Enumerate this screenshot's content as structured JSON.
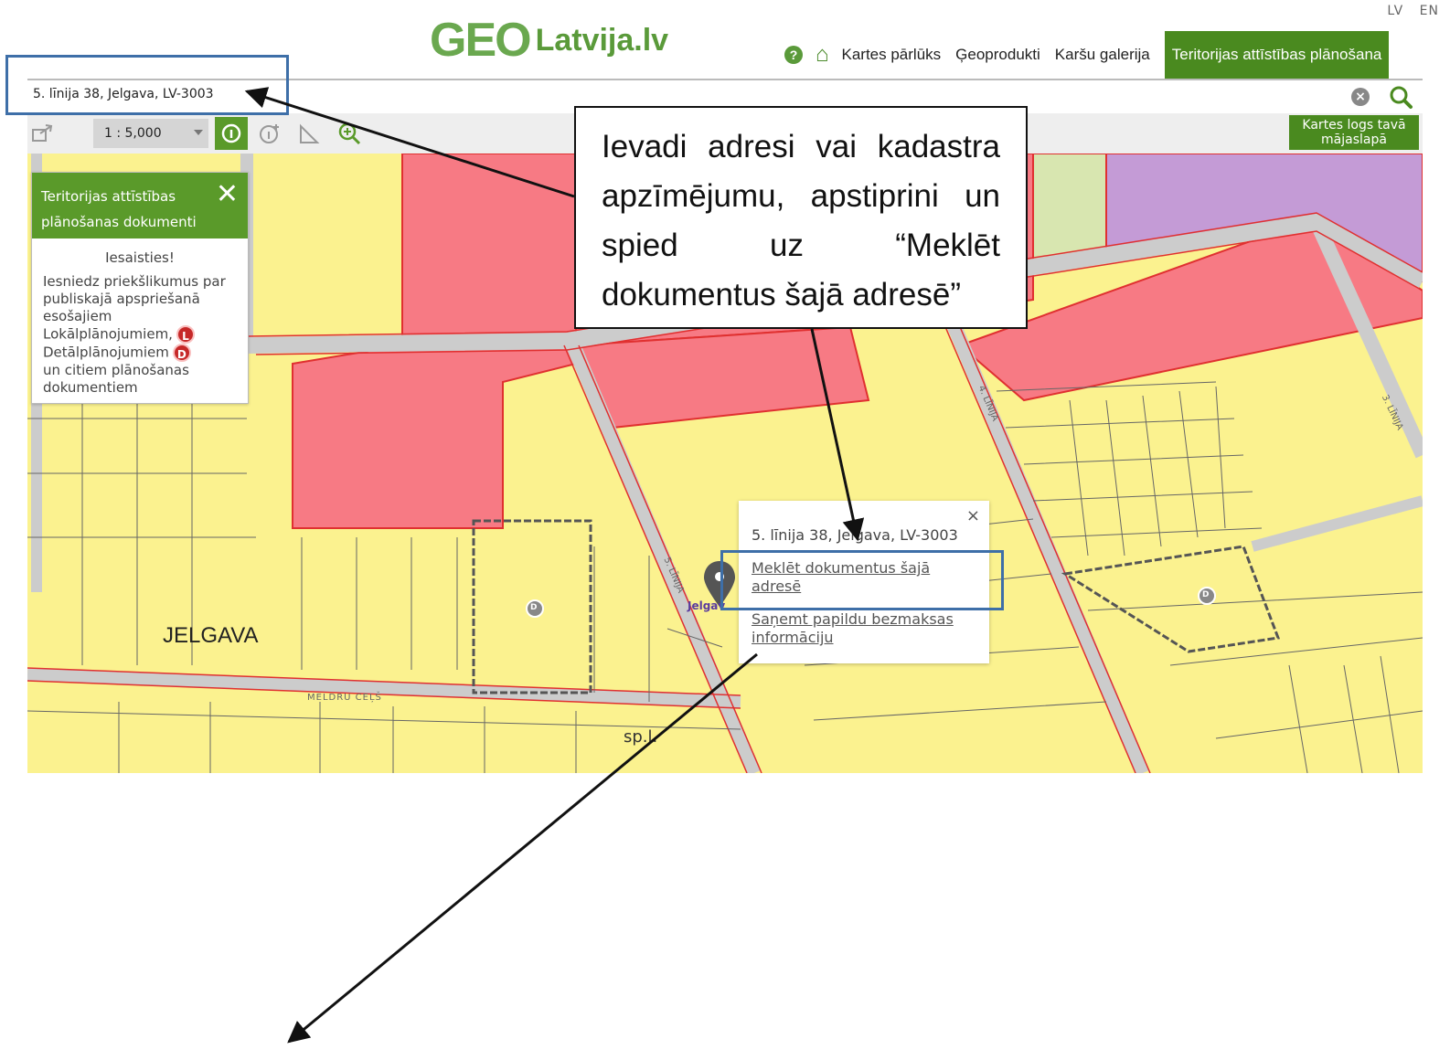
{
  "header": {
    "languages": [
      "LV",
      "EN"
    ],
    "logo": {
      "geo": "GEO",
      "rest": "Latvija.lv"
    },
    "nav": {
      "help_icon": "?",
      "items": [
        "Kartes pārlūks",
        "Ģeoprodukti",
        "Karšu galerija"
      ],
      "active": "Teritorijas attīstības plānošana"
    }
  },
  "search": {
    "value": "5. līnija 38, Jelgava, LV-3003",
    "clear_icon": "×"
  },
  "toolbar": {
    "scale": "1 : 5,000",
    "embed_button": "Kartes logs tavā mājaslapā"
  },
  "panel": {
    "title": "Teritorijas attīstības plānošanas dokumenti",
    "close": "✕",
    "subtitle": "Iesaisties!",
    "line1": "Iesniedz priekšlikumus par publiskajā apspriešanā esošajiem",
    "line2": "Lokālplānojumiem,",
    "line3": "Detālplānojumiem",
    "line4": "un citiem plānošanas dokumentiem",
    "badge_l": "L",
    "badge_d": "D"
  },
  "map": {
    "city_label": "JELGAVA",
    "street_meldru": "MELDRU CEĻŠ",
    "street_5": "5. LĪNIJA",
    "street_4": "4. LĪNIJA",
    "street_3": "3. LĪNIJA",
    "marker_label": "Jelgav",
    "sp_label": "sp.l.",
    "d_marker": "D"
  },
  "popup": {
    "close": "×",
    "address": "5. līnija 38, Jelgava, LV-3003",
    "link_search": "Meklēt dokumentus šajā adresē",
    "link_info": "Saņemt papildu bezmaksas informāciju"
  },
  "callout": {
    "text": "Ievadi adresi vai kadastra apzīmējumu, apstiprini un spied uz “Meklēt dokumentus šajā adresē”"
  }
}
